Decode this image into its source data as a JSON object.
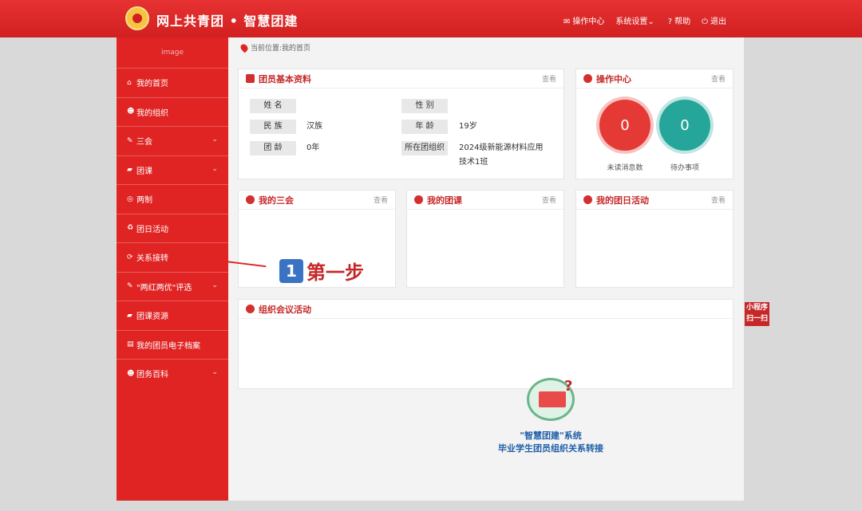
{
  "header": {
    "brand": "网上共青团 • 智慧团建",
    "nav": [
      {
        "icon": "mail-icon",
        "label": "操作中心"
      },
      {
        "icon": "settings-icon",
        "label": "系统设置"
      },
      {
        "icon": "help-icon",
        "label": "帮助"
      },
      {
        "icon": "power-icon",
        "label": "退出"
      }
    ]
  },
  "sidebar": {
    "logo_text": "image",
    "items": [
      {
        "label": "我的首页"
      },
      {
        "label": "我的组织"
      },
      {
        "label": "三会"
      },
      {
        "label": "团课"
      },
      {
        "label": "两制"
      },
      {
        "label": "团日活动"
      },
      {
        "label": "关系接转"
      },
      {
        "label": "\"两红两优\"评选"
      },
      {
        "label": "团课资源"
      },
      {
        "label": "我的团员电子档案"
      },
      {
        "label": "团务百科"
      }
    ]
  },
  "breadcrumb": "当前位置:我的首页",
  "profile": {
    "title": "团员基本资料",
    "view": "查看",
    "labels": {
      "name": "姓 名",
      "gender": "性 别",
      "ethnicity": "民 族",
      "age": "年 龄",
      "league_age": "团 龄",
      "org": "所在团组织"
    },
    "values": {
      "ethnicity": "汉族",
      "age": "19岁",
      "league_age": "0年",
      "org": "2024级新能源材料应用技术1班"
    }
  },
  "ops": {
    "title": "操作中心",
    "view": "查看",
    "unread_count": "0",
    "unread_label": "未读消息数",
    "todo_count": "0",
    "todo_label": "待办事项"
  },
  "panels": {
    "meetings": {
      "title": "我的三会",
      "view": "查看"
    },
    "lessons": {
      "title": "我的团课",
      "view": "查看"
    },
    "activities": {
      "title": "我的团日活动",
      "view": "查看"
    },
    "org_meetings": {
      "title": "组织会议活动"
    }
  },
  "annotation": {
    "number": "1",
    "text": "第一步"
  },
  "mini_program": {
    "line1": "小程序",
    "line2": "扫一扫"
  },
  "promo": {
    "line1": "\"智慧团建\"系统",
    "line2": "毕业学生团员组织关系转接"
  },
  "colors": {
    "primary": "#e02424",
    "circle_red": "#e53935",
    "circle_teal": "#26a69a"
  }
}
